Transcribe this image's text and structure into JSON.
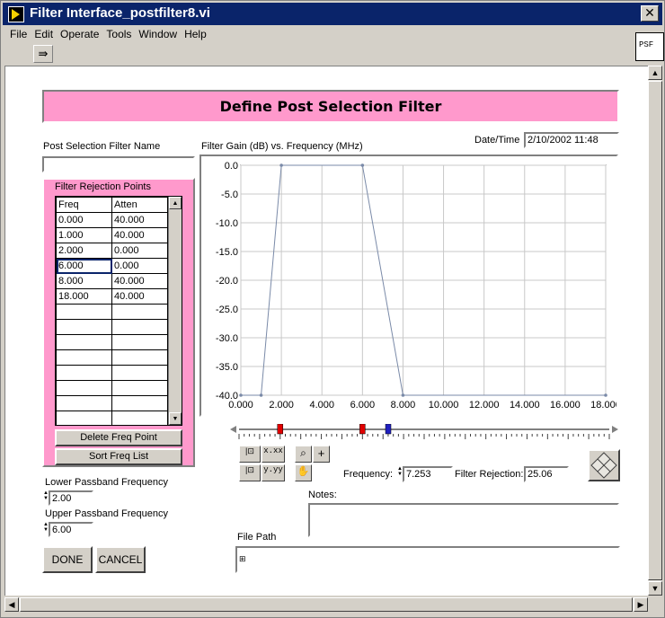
{
  "window": {
    "title": "Filter Interface_postfilter8.vi",
    "close_glyph": "✕"
  },
  "menu": [
    "File",
    "Edit",
    "Operate",
    "Tools",
    "Window",
    "Help"
  ],
  "header": {
    "title": "Define Post Selection Filter"
  },
  "filter_name": {
    "label": "Post Selection Filter Name",
    "value": ""
  },
  "datetime": {
    "label": "Date/Time",
    "value": "2/10/2002 11:48"
  },
  "rejection_table": {
    "title": "Filter Rejection Points",
    "columns": [
      "Freq",
      "Atten"
    ],
    "rows": [
      [
        "0.000",
        "40.000"
      ],
      [
        "1.000",
        "40.000"
      ],
      [
        "2.000",
        "0.000"
      ],
      [
        "6.000",
        "0.000"
      ],
      [
        "8.000",
        "40.000"
      ],
      [
        "18.000",
        "40.000"
      ]
    ],
    "selected_row": 3,
    "blank_rows": 8
  },
  "buttons": {
    "delete_freq": "Delete Freq Point",
    "sort_freq": "Sort Freq List",
    "done": "DONE",
    "cancel": "CANCEL"
  },
  "lower_passband": {
    "label": "Lower Passband Frequency",
    "value": "2.00"
  },
  "upper_passband": {
    "label": "Upper Passband Frequency",
    "value": "6.00"
  },
  "chart_data": {
    "type": "line",
    "title": "Filter Gain (dB) vs. Frequency (MHz)",
    "xlim": [
      0,
      18
    ],
    "ylim": [
      -40,
      0
    ],
    "xticks": [
      "0.000",
      "2.000",
      "4.000",
      "6.000",
      "8.000",
      "10.000",
      "12.000",
      "14.000",
      "16.000",
      "18.000"
    ],
    "yticks": [
      "0.0",
      "-5.0",
      "-10.0",
      "-15.0",
      "-20.0",
      "-25.0",
      "-30.0",
      "-35.0",
      "-40.0"
    ],
    "grid": true,
    "x": [
      0,
      1,
      2,
      6,
      8,
      18
    ],
    "y": [
      -40,
      -40,
      0,
      0,
      -40,
      -40
    ],
    "line_color": "#7a8aa8"
  },
  "slider": {
    "markers": [
      {
        "value": 2,
        "color": "#e00000"
      },
      {
        "value": 6,
        "color": "#e00000"
      },
      {
        "value": 7.253,
        "color": "#2020c0"
      }
    ],
    "min": 0,
    "max": 18
  },
  "frequency": {
    "label": "Frequency:",
    "value": "7.253"
  },
  "filter_rejection": {
    "label": "Filter Rejection:",
    "value": "25.06"
  },
  "notes": {
    "label": "Notes:",
    "value": ""
  },
  "file_path": {
    "label": "File Path",
    "value": ""
  },
  "palette": {
    "x_fmt": "x.xx",
    "y_fmt": "y.yy"
  }
}
